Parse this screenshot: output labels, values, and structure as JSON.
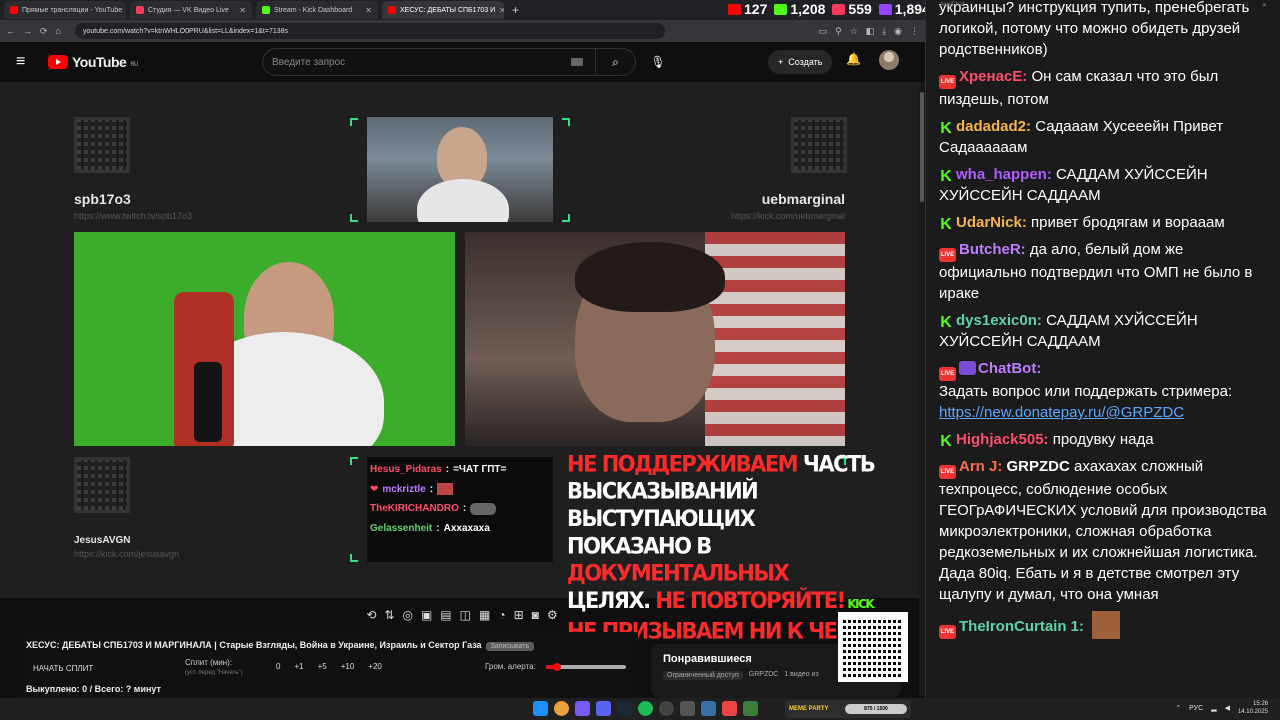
{
  "browser": {
    "tabs": [
      {
        "title": "Прямые трансляции - YouTube",
        "color": "#ff0000",
        "active": false
      },
      {
        "title": "Студия — VK Видео Live",
        "color": "#ff3b5c",
        "active": false
      },
      {
        "title": "Stream - Kick Dashboard",
        "color": "#53fc18",
        "active": false
      },
      {
        "title": "ХЕСУС: ДЕБАТЫ СПБ1703 И",
        "color": "#ff0000",
        "active": true
      }
    ],
    "url": "youtube.com/watch?v=ktnWHLO0PRU&list=LL&index=1&t=7138s"
  },
  "viewer_stats": [
    {
      "value": "127",
      "color": "#ff0000",
      "icon": "youtube-icon"
    },
    {
      "value": "1,208",
      "color": "#53fc18",
      "icon": "kick-icon"
    },
    {
      "value": "559",
      "color": "#ff3b5c",
      "icon": "vk-live-icon"
    },
    {
      "value": "1,894",
      "color": "#9146ff",
      "icon": "total-viewers-icon"
    }
  ],
  "youtube": {
    "logo": "YouTube",
    "region": "RU",
    "search_placeholder": "Введите запрос",
    "create_label": "Создать"
  },
  "stream": {
    "left_name": "spb17o3",
    "left_url": "https://www.twitch.tv/spb17o3",
    "right_name": "uebmarginal",
    "right_url": "https://kick.com/uebmarginal",
    "bottom_name": "JesusAVGN",
    "bottom_url": "https://kick.com/jesusavgn",
    "overlay_chat": [
      {
        "user": "Hesus_Pidaras",
        "text": "=ЧАТ ГПТ=",
        "color": "#ff4e6a"
      },
      {
        "user": "mckriztle",
        "text": "",
        "color": "#c07cff"
      },
      {
        "user": "TheKIRICHANDRO",
        "text": "",
        "color": "#ff4e6a"
      },
      {
        "user": "Gelassenheit",
        "text": "Аххахаха",
        "color": "#5fd26a"
      }
    ],
    "warning": {
      "l1a": "Не поддерживаем",
      "l1b": " часть",
      "l2": "высказываний выступающих",
      "l3a": "показано в ",
      "l3b": "документальных",
      "l4a": "целях. ",
      "l4b": "Не повторяйте!",
      "l4k": " KICK",
      "l5": "Не призываем ни к чему!"
    }
  },
  "video": {
    "title": "ХЕСУС: ДЕБАТЫ СПБ1703 И МАРГИНАЛА | Старые Взгляды, Война в Украине, Израиль и Сектор Газа",
    "tag": "Записывать",
    "start_split": "НАЧАТЬ СПЛИТ",
    "split_label": "Сплит (мин):",
    "split_hint": "(уст. перед \"Начать\")",
    "splits": [
      "0",
      "+1",
      "+5",
      "+10",
      "+20"
    ],
    "alert_label": "Гром. алерта:",
    "alert_volume": 0.14,
    "votes": "Выкуплено: 0 / Всего: ? минут",
    "liked_title": "Понравившиеся",
    "liked_access": "Ограниченный доступ",
    "liked_owner": "GRPZDC",
    "liked_count": "1 видео из"
  },
  "chat": {
    "app_title": "AxelChat",
    "messages": [
      {
        "badge": "none",
        "user": "",
        "color": "#fff",
        "text": "украинцы? инструкция тупить, пренебрегать логикой, потому что можно обидеть друзей родственников)"
      },
      {
        "badge": "live",
        "user": "ХренасЕ:",
        "color": "#ff4e6a",
        "text": "Он сам сказал что это был пиздешь, потом"
      },
      {
        "badge": "kick",
        "user": "dadadad2:",
        "color": "#f5b54d",
        "text": "Садааам Хусееейн Привет Садаааааам"
      },
      {
        "badge": "kick",
        "user": "wha_happen:",
        "color": "#b05cff",
        "text": "САДДАМ ХУЙССЕЙН ХУЙССЕЙН САДДААМ"
      },
      {
        "badge": "kick",
        "user": "UdarNick:",
        "color": "#f5b54d",
        "text": "привет бродягам и вораaам"
      },
      {
        "badge": "live",
        "user": "ButcheR:",
        "color": "#c07cff",
        "text": "да ало, белый дом же официально подтвердил что ОМП не было в ираке"
      },
      {
        "badge": "kick",
        "user": "dys1exic0n:",
        "color": "#5fd2a6",
        "text": "САДДАМ ХУЙССЕЙН ХУЙССЕЙН САДДААМ"
      },
      {
        "badge": "live",
        "user": "ChatBot:",
        "color": "#c07cff",
        "text": "Задать вопрос или поддержать стримера:",
        "link": "https://new.donatepay.ru/@GRPZDC"
      },
      {
        "badge": "kick",
        "user": "Highjack505:",
        "color": "#ff4e6a",
        "text": "продувку нада"
      },
      {
        "badge": "live",
        "user": "Arn J:",
        "color": "#ff6b4a",
        "text": "ахахахах сложный техпроцесс, соблюдение особых ГЕОГрАФИЧЕСКИХ условий для производства микроэлектроники, сложная обработка редкоземельных и их сложнейшая логистика. Дада 80iq. Ебать и я в детстве смотрел эту щалупу и думал, что она умная",
        "mention": "GRPZDC"
      },
      {
        "badge": "live",
        "user": "TheIronCurtain 1:",
        "color": "#5fd2a6",
        "text": ""
      }
    ]
  },
  "taskbar": {
    "meme_label": "MEME PARTY",
    "meme_progress": "875 / 1500",
    "lang": "РУС",
    "time": "15:26",
    "date": "14.10.2025"
  }
}
